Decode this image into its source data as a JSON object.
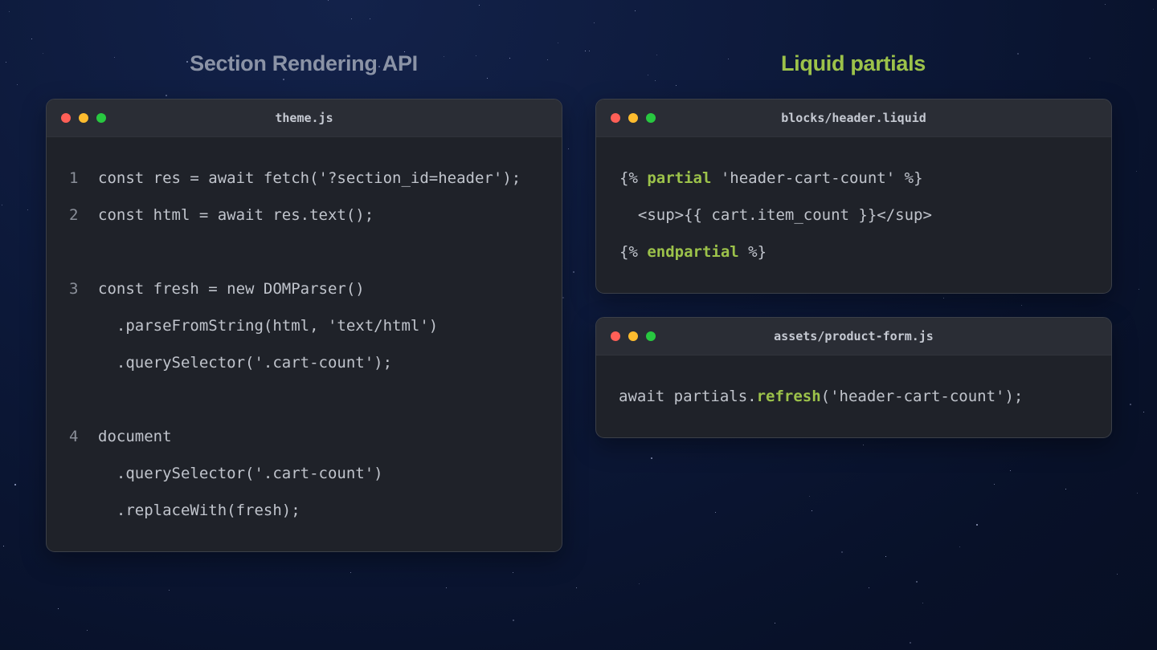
{
  "headings": {
    "left": "Section Rendering API",
    "right": "Liquid partials"
  },
  "colors": {
    "background": "#0c1838",
    "heading_left": "#8b93a6",
    "heading_right": "#9cc24a",
    "keyword": "#9cc24a",
    "window_bg": "#1f2229",
    "titlebar_bg": "#2a2d35",
    "dot_red": "#ff5f57",
    "dot_yellow": "#febc2e",
    "dot_green": "#28c840"
  },
  "windows": {
    "theme": {
      "title": "theme.js",
      "line_numbers": [
        "1",
        "2",
        "3",
        "4"
      ],
      "lines": [
        "const res = await fetch('?section_id=header');",
        "const html = await res.text();",
        "const fresh = new DOMParser()",
        "  .parseFromString(html, 'text/html')",
        "  .querySelector('.cart-count');",
        "document",
        "  .querySelector('.cart-count')",
        "  .replaceWith(fresh);"
      ]
    },
    "header": {
      "title": "blocks/header.liquid",
      "line1": {
        "pre": "{% ",
        "kw": "partial",
        "post": " 'header-cart-count' %}"
      },
      "line2": "  <sup>{{ cart.item_count }}</sup>",
      "line3": {
        "pre": "{% ",
        "kw": "endpartial",
        "post": " %}"
      }
    },
    "product": {
      "title": "assets/product-form.js",
      "line1": {
        "pre": "await partials.",
        "kw": "refresh",
        "post": "('header-cart-count');"
      }
    }
  }
}
